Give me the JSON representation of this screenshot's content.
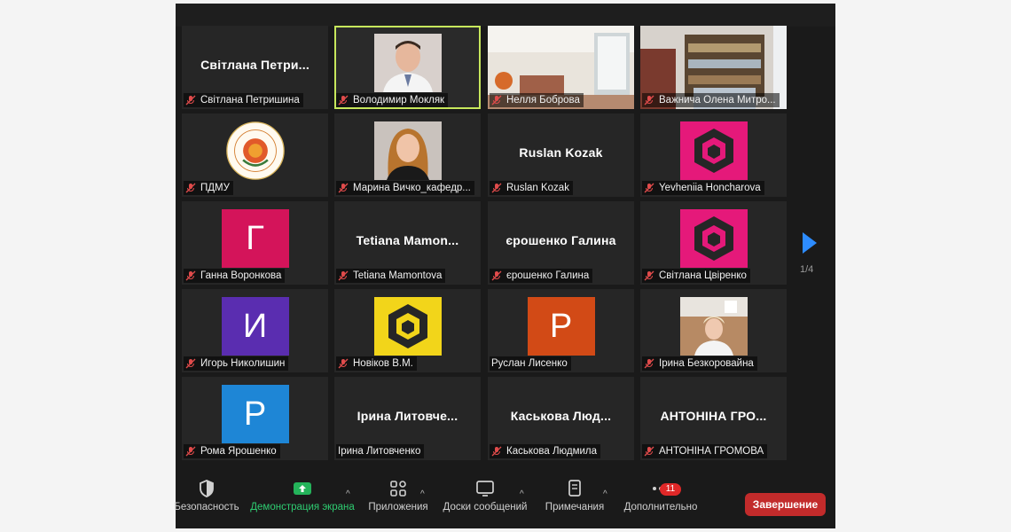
{
  "pagination": {
    "current": "1/4"
  },
  "tiles": [
    {
      "label": "Світлана Петришина",
      "center": "Світлана  Петри..."
    },
    {
      "label": "Володимир Мокляк"
    },
    {
      "label": "Нелля Боброва"
    },
    {
      "label": "Важнича Олена Митро..."
    },
    {
      "label": "ПДМУ"
    },
    {
      "label": "Марина Вичко_кафедр..."
    },
    {
      "label": "Ruslan Kozak",
      "center": "Ruslan Kozak"
    },
    {
      "label": "Yevheniia Honcharova"
    },
    {
      "label": "Ганна Воронкова",
      "letter": "Г",
      "color": "#d4145a"
    },
    {
      "label": "Tetiana Mamontova",
      "center": "Tetiana  Mamon..."
    },
    {
      "label": "єрошенко Галина",
      "center": "єрошенко Галина"
    },
    {
      "label": "Світлана Цвіренко"
    },
    {
      "label": "Игорь Николишин",
      "letter": "И",
      "color": "#5a2db0"
    },
    {
      "label": "Новіков В.М."
    },
    {
      "label": "Руслан Лисенко",
      "letter": "Р",
      "color": "#d24a16"
    },
    {
      "label": "Ірина Безкоровайна"
    },
    {
      "label": "Рома Ярошенко",
      "letter": "Р",
      "color": "#1e86d6"
    },
    {
      "label": "Ірина Литовченко",
      "center": "Ірина  Литовче..."
    },
    {
      "label": "Каськова Людмила",
      "center": "Каськова  Люд..."
    },
    {
      "label": "АНТОНІНА ГРОМОВА",
      "center": "АНТОНІНА  ГРО..."
    }
  ],
  "toolbar": {
    "security": "Безопасность",
    "share": "Демонстрация экрана",
    "apps": "Приложения",
    "whiteboards": "Доски сообщений",
    "notes": "Примечания",
    "more": "Дополнительно",
    "more_badge": "11",
    "end": "Завершение"
  },
  "colors": {
    "accent": "#2d8cff",
    "share": "#24b35a",
    "active_border": "#c7e75c",
    "end": "#c22b2b"
  }
}
